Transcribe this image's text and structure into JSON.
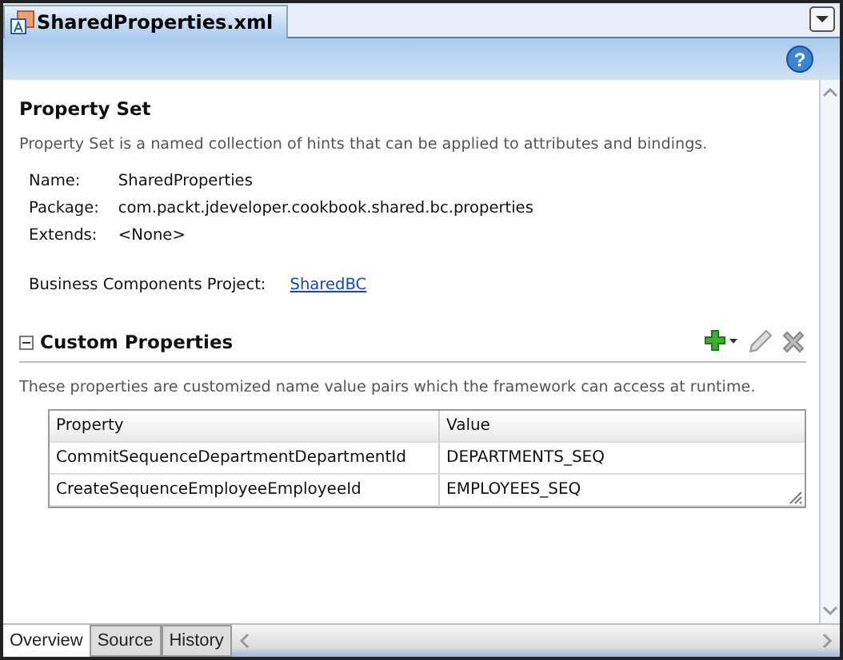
{
  "editor_tab": {
    "title": "SharedProperties.xml",
    "selected": true
  },
  "help_button": "?",
  "property_set": {
    "heading": "Property Set",
    "description": "Property Set is a named collection of hints that can be applied to attributes and bindings.",
    "fields": [
      {
        "label": "Name:",
        "value": "SharedProperties"
      },
      {
        "label": "Package:",
        "value": "com.packt.jdeveloper.cookbook.shared.bc.properties"
      },
      {
        "label": "Extends:",
        "value": "<None>"
      }
    ],
    "project": {
      "label": "Business Components Project:",
      "link": "SharedBC"
    }
  },
  "custom_properties": {
    "heading": "Custom Properties",
    "expanded": true,
    "description": "These properties are customized name value pairs which the framework can access at runtime.",
    "columns": [
      "Property",
      "Value"
    ],
    "rows": [
      [
        "CommitSequenceDepartmentDepartmentId",
        "DEPARTMENTS_SEQ"
      ],
      [
        "CreateSequenceEmployeeEmployeeId",
        "EMPLOYEES_SEQ"
      ]
    ]
  },
  "bottom_tabs": [
    {
      "label": "Overview",
      "selected": true
    },
    {
      "label": "Source",
      "selected": false
    },
    {
      "label": "History",
      "selected": false
    }
  ]
}
